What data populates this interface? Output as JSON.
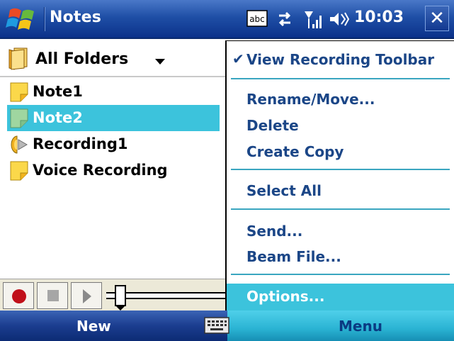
{
  "titlebar": {
    "app_title": "Notes",
    "clock": "10:03",
    "close": "✕",
    "abc": "abc"
  },
  "folder": {
    "label": "All Folders"
  },
  "files": [
    {
      "name": "Note1",
      "icon": "note-icon",
      "selected": false
    },
    {
      "name": "Note2",
      "icon": "note-icon",
      "selected": true
    },
    {
      "name": "Recording1",
      "icon": "audio-recording-icon",
      "selected": false
    },
    {
      "name": "Voice Recording",
      "icon": "note-icon",
      "selected": false
    }
  ],
  "menu": {
    "view_recording_toolbar": "View Recording Toolbar",
    "rename_move": "Rename/Move...",
    "delete": "Delete",
    "create_copy": "Create Copy",
    "select_all": "Select All",
    "send": "Send...",
    "beam_file": "Beam File...",
    "options": "Options..."
  },
  "softkeys": {
    "left": "New",
    "right": "Menu"
  },
  "colors": {
    "accent": "#3cc3dc",
    "titlebar": "#1f4fa6",
    "menu_text": "#1b4687"
  }
}
